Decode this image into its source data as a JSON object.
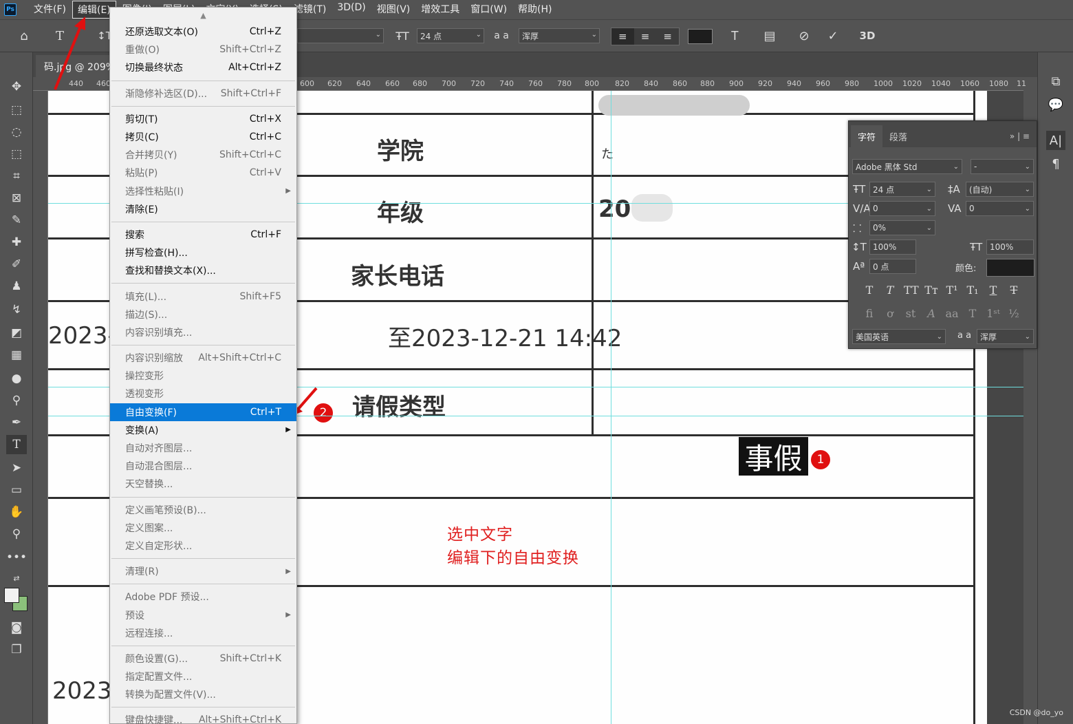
{
  "menubar": {
    "logo": "Ps",
    "items": [
      "文件(F)",
      "编辑(E)",
      "图像(I)",
      "图层(L)",
      "文字(Y)",
      "选择(S)",
      "滤镜(T)",
      "3D(D)",
      "视图(V)",
      "增效工具",
      "窗口(W)",
      "帮助(H)"
    ],
    "active_index": 1
  },
  "optbar": {
    "font_size": "24 点",
    "aa_label": "a a",
    "aa_mode": "浑厚",
    "three_d": "3D"
  },
  "document": {
    "tab_title": "码.jpg @ 209%",
    "ruler_ticks": [
      "440",
      "460",
      "600",
      "620",
      "640",
      "660",
      "680",
      "700",
      "720",
      "740",
      "760",
      "780",
      "800",
      "820",
      "840",
      "860",
      "880",
      "900",
      "920",
      "940",
      "960",
      "980",
      "1000",
      "1020",
      "1040",
      "1060",
      "1080",
      "11"
    ],
    "labels": {
      "college": "学院",
      "grade": "年级",
      "parent_phone": "家长电话",
      "leave_type": "请假类型",
      "date_range": "至2023-12-21 14:42",
      "date_left": "2023-",
      "date_bottom": "2023",
      "grade_value": "20",
      "partial_mark": "た"
    },
    "selected_text": "事假",
    "annotation_lines": [
      "选中文字",
      "编辑下的自由变换"
    ],
    "badges": [
      "1",
      "2"
    ],
    "watermark": "CSDN @do_yo"
  },
  "edit_menu": {
    "groups": [
      [
        {
          "label": "还原选取文本(O)",
          "shortcut": "Ctrl+Z",
          "enabled": true
        },
        {
          "label": "重做(O)",
          "shortcut": "Shift+Ctrl+Z",
          "enabled": false
        },
        {
          "label": "切换最终状态",
          "shortcut": "Alt+Ctrl+Z",
          "enabled": true
        }
      ],
      [
        {
          "label": "渐隐修补选区(D)...",
          "shortcut": "Shift+Ctrl+F",
          "enabled": false
        }
      ],
      [
        {
          "label": "剪切(T)",
          "shortcut": "Ctrl+X",
          "enabled": true
        },
        {
          "label": "拷贝(C)",
          "shortcut": "Ctrl+C",
          "enabled": true
        },
        {
          "label": "合并拷贝(Y)",
          "shortcut": "Shift+Ctrl+C",
          "enabled": false
        },
        {
          "label": "粘贴(P)",
          "shortcut": "Ctrl+V",
          "enabled": false
        },
        {
          "label": "选择性粘贴(I)",
          "shortcut": "",
          "enabled": false,
          "submenu": true
        },
        {
          "label": "清除(E)",
          "shortcut": "",
          "enabled": true
        }
      ],
      [
        {
          "label": "搜索",
          "shortcut": "Ctrl+F",
          "enabled": true
        },
        {
          "label": "拼写检查(H)...",
          "shortcut": "",
          "enabled": true
        },
        {
          "label": "查找和替换文本(X)...",
          "shortcut": "",
          "enabled": true
        }
      ],
      [
        {
          "label": "填充(L)...",
          "shortcut": "Shift+F5",
          "enabled": false
        },
        {
          "label": "描边(S)...",
          "shortcut": "",
          "enabled": false
        },
        {
          "label": "内容识别填充...",
          "shortcut": "",
          "enabled": false
        }
      ],
      [
        {
          "label": "内容识别缩放",
          "shortcut": "Alt+Shift+Ctrl+C",
          "enabled": false
        },
        {
          "label": "操控变形",
          "shortcut": "",
          "enabled": false
        },
        {
          "label": "透视变形",
          "shortcut": "",
          "enabled": false
        },
        {
          "label": "自由变换(F)",
          "shortcut": "Ctrl+T",
          "enabled": true,
          "highlighted": true
        },
        {
          "label": "变换(A)",
          "shortcut": "",
          "enabled": true,
          "submenu": true
        },
        {
          "label": "自动对齐图层...",
          "shortcut": "",
          "enabled": false
        },
        {
          "label": "自动混合图层...",
          "shortcut": "",
          "enabled": false
        },
        {
          "label": "天空替换...",
          "shortcut": "",
          "enabled": false
        }
      ],
      [
        {
          "label": "定义画笔预设(B)...",
          "shortcut": "",
          "enabled": false
        },
        {
          "label": "定义图案...",
          "shortcut": "",
          "enabled": false
        },
        {
          "label": "定义自定形状...",
          "shortcut": "",
          "enabled": false
        }
      ],
      [
        {
          "label": "清理(R)",
          "shortcut": "",
          "enabled": false,
          "submenu": true
        }
      ],
      [
        {
          "label": "Adobe PDF 预设...",
          "shortcut": "",
          "enabled": false
        },
        {
          "label": "预设",
          "shortcut": "",
          "enabled": false,
          "submenu": true
        },
        {
          "label": "远程连接...",
          "shortcut": "",
          "enabled": false
        }
      ],
      [
        {
          "label": "颜色设置(G)...",
          "shortcut": "Shift+Ctrl+K",
          "enabled": false
        },
        {
          "label": "指定配置文件...",
          "shortcut": "",
          "enabled": false
        },
        {
          "label": "转换为配置文件(V)...",
          "shortcut": "",
          "enabled": false
        }
      ],
      [
        {
          "label": "键盘快捷键...",
          "shortcut": "Alt+Shift+Ctrl+K",
          "enabled": false
        }
      ]
    ]
  },
  "char_panel": {
    "tabs": [
      "字符",
      "段落"
    ],
    "font_family": "Adobe 黑体 Std",
    "font_style": "-",
    "size": "24 点",
    "leading": "(自动)",
    "kerning": "0",
    "tracking": "0",
    "scale_pct": "0%",
    "vscale": "100%",
    "hscale": "100%",
    "baseline": "0 点",
    "color_label": "颜色:",
    "language": "美国英语",
    "aa_mode": "浑厚",
    "aa_label": "a a"
  }
}
